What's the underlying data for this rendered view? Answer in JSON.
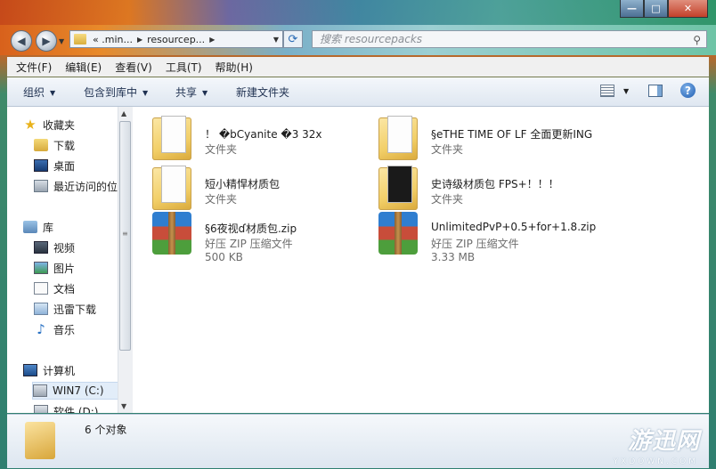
{
  "window": {
    "controls": {
      "minimize": "—",
      "maximize": "□",
      "close": "✕"
    }
  },
  "nav": {
    "back_icon": "back-arrow-icon",
    "forward_icon": "forward-arrow-icon",
    "address_segments": [
      "« .min...",
      "resourcep..."
    ],
    "search_placeholder": "搜索 resourcepacks"
  },
  "menubar": [
    "文件(F)",
    "编辑(E)",
    "查看(V)",
    "工具(T)",
    "帮助(H)"
  ],
  "commandbar": {
    "organize": "组织",
    "include_library": "包含到库中",
    "share": "共享",
    "new_folder": "新建文件夹"
  },
  "sidebar": {
    "favorites_label": "收藏夹",
    "favorites": [
      "下载",
      "桌面",
      "最近访问的位"
    ],
    "libraries_label": "库",
    "libraries": [
      "视频",
      "图片",
      "文档",
      "迅雷下载",
      "音乐"
    ],
    "computer_label": "计算机",
    "drives": [
      "WIN7 (C:)",
      "软件 (D:)"
    ]
  },
  "files": [
    {
      "name": "！ �bCyanite �3 32x",
      "type": "文件夹",
      "size": "",
      "kind": "folder"
    },
    {
      "name": "§eTHE TIME OF LF 全面更新ING",
      "type": "文件夹",
      "size": "",
      "kind": "folder"
    },
    {
      "name": "短小精悍材质包",
      "type": "文件夹",
      "size": "",
      "kind": "folder"
    },
    {
      "name": "史诗级材质包 FPS+！！！",
      "type": "文件夹",
      "size": "",
      "kind": "folder"
    },
    {
      "name": "§6夜视ɗ材质包.zip",
      "type": "好压 ZIP 压缩文件",
      "size": "500 KB",
      "kind": "zip"
    },
    {
      "name": "UnlimitedPvP+0.5+for+1.8.zip",
      "type": "好压 ZIP 压缩文件",
      "size": "3.33 MB",
      "kind": "zip"
    }
  ],
  "status": {
    "count": "6 个对象"
  },
  "watermark": {
    "brand": "游迅网",
    "site": "YXDOWN.COM"
  }
}
